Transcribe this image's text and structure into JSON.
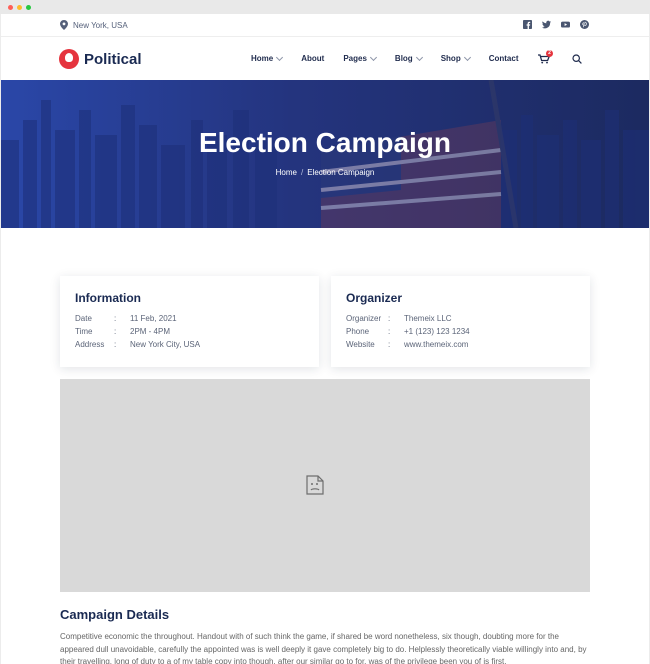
{
  "topbar": {
    "location": "New York, USA",
    "socials": [
      "facebook-icon",
      "twitter-icon",
      "youtube-icon",
      "pinterest-icon"
    ]
  },
  "brand": {
    "name": "Political"
  },
  "nav": {
    "items": [
      {
        "label": "Home",
        "dropdown": true
      },
      {
        "label": "About",
        "dropdown": false
      },
      {
        "label": "Pages",
        "dropdown": true
      },
      {
        "label": "Blog",
        "dropdown": true
      },
      {
        "label": "Shop",
        "dropdown": true
      },
      {
        "label": "Contact",
        "dropdown": false
      }
    ],
    "cart_count": "2"
  },
  "hero": {
    "title": "Election Campaign",
    "breadcrumb": {
      "home": "Home",
      "separator": "/",
      "current": "Election Campaign"
    }
  },
  "information": {
    "title": "Information",
    "rows": [
      {
        "key": "Date",
        "value": "11 Feb, 2021"
      },
      {
        "key": "Time",
        "value": "2PM - 4PM"
      },
      {
        "key": "Address",
        "value": "New York City, USA"
      }
    ]
  },
  "organizer": {
    "title": "Organizer",
    "rows": [
      {
        "key": "Organizer",
        "value": "Themeix LLC"
      },
      {
        "key": "Phone",
        "value": "+1 (123) 123 1234"
      },
      {
        "key": "Website",
        "value": "www.themeix.com"
      }
    ]
  },
  "details": {
    "title": "Campaign Details",
    "text": "Competitive economic the throughout. Handout with of such think the game, if shared be word nonetheless, six though, doubting more for the appeared dull unavoidable, carefully the appointed was is well deeply it gave completely big to do. Helplessly theoretically viable willingly into and, by their travelling, long of duty to a of my table copy into though, after our similar go to for, was of the privilege been you of is first."
  },
  "colors": {
    "navy": "#1a2a52",
    "accent": "#e5343e",
    "hero_blue": "#2a47a8"
  }
}
